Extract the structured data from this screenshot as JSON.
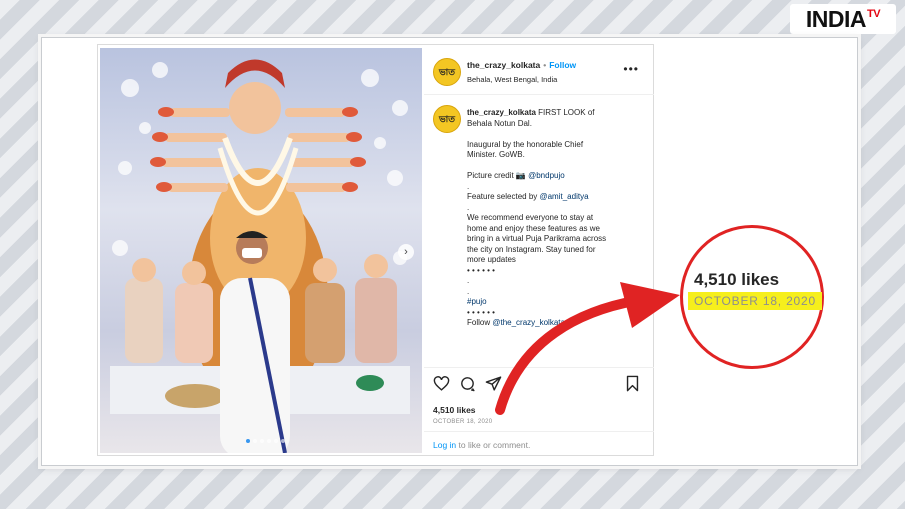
{
  "brand": {
    "logo_main": "INDIA",
    "logo_tv": "TV",
    "accent": "#e30613"
  },
  "post": {
    "username": "the_crazy_kolkata",
    "separator": "•",
    "follow_label": "Follow",
    "location": "Behala, West Bengal, India",
    "more_label": "•••",
    "avatar_text": "ভাত",
    "caption": {
      "username": "the_crazy_kolkata",
      "line1": "FIRST LOOK of",
      "line2": "Behala Notun Dal.",
      "line3": "Inaugural by the honorable Chief",
      "line4": "Minister. GoWB.",
      "line5_prefix": "Picture credit 📷 ",
      "line5_link": "@bndpujo",
      "line6": ".",
      "line7_prefix": "Feature selected by ",
      "line7_link": "@amit_aditya",
      "line8": ".",
      "line9": "We recommend everyone to stay at",
      "line10": "home and enjoy these features as we",
      "line11": "bring in a virtual Puja Parikrama across",
      "line12": "the city on Instagram. Stay tuned for",
      "line13": "more updates",
      "line14": "• • • • • •",
      "line15": ".",
      "line16": ".",
      "line17": "#pujo",
      "line18": "• • • • • •",
      "line19_prefix": "Follow ",
      "line19_link": "@the_crazy_kolkata"
    },
    "likes": "4,510 likes",
    "date": "OCTOBER 18, 2020",
    "login_link": "Log in",
    "login_rest": " to like or comment."
  },
  "zoom": {
    "likes": "4,510 likes",
    "date": "OCTOBER 18, 2020",
    "highlight": "#f6ef1c",
    "circle_color": "#e02323"
  },
  "carousel": {
    "total_slides": 6,
    "current_slide": 1
  }
}
